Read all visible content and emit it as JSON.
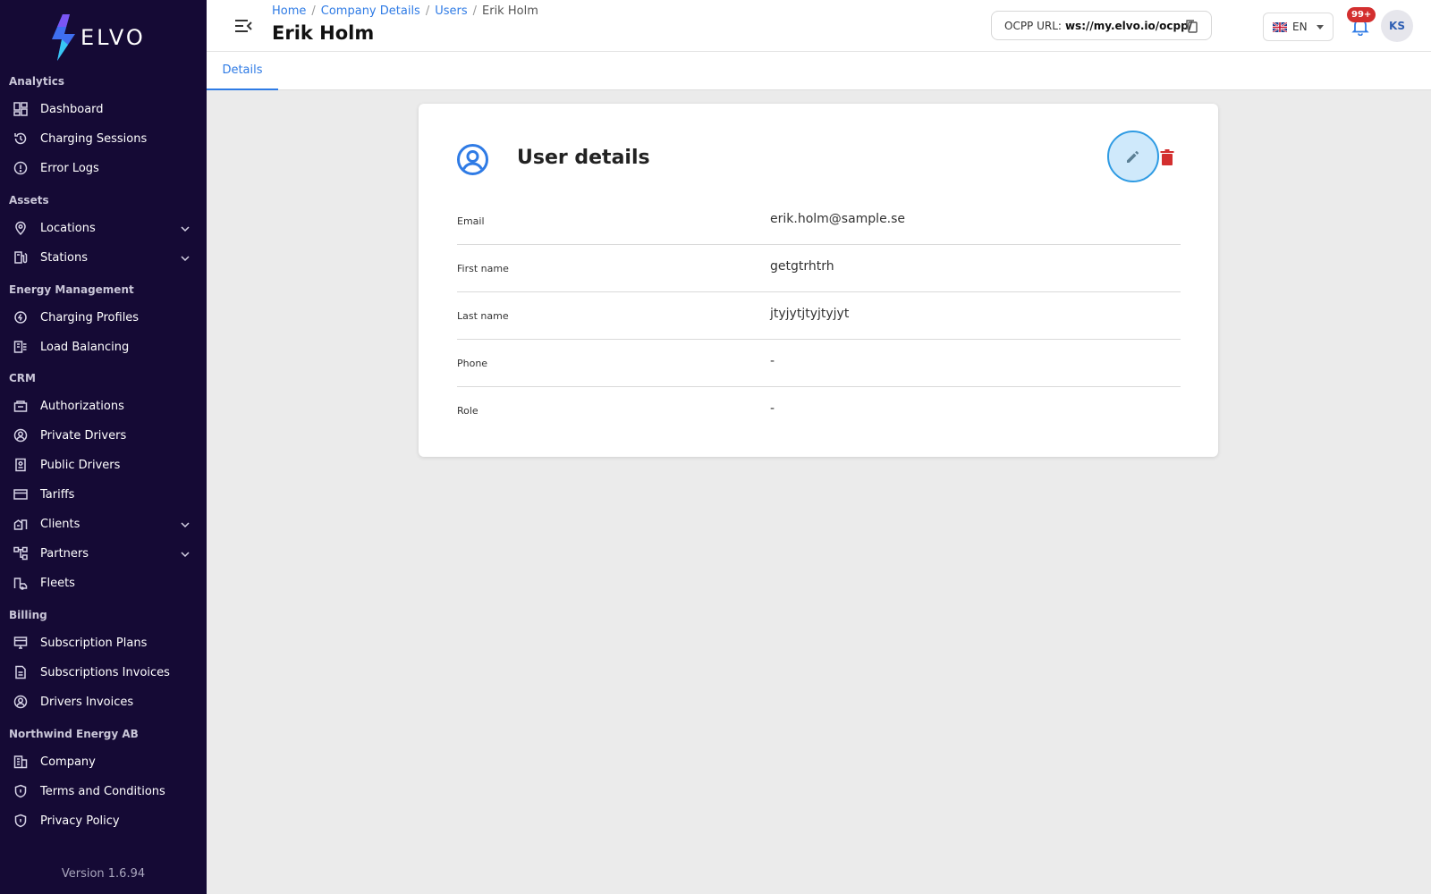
{
  "brand": {
    "name": "ELVO"
  },
  "sidebar": {
    "sections": [
      {
        "title": "Analytics"
      },
      {
        "title": "Assets"
      },
      {
        "title": "Energy Management"
      },
      {
        "title": "CRM"
      },
      {
        "title": "Billing"
      },
      {
        "title": "Northwind Energy AB"
      }
    ],
    "items": [
      {
        "label": "Dashboard",
        "icon": "dashboard-icon"
      },
      {
        "label": "Charging Sessions",
        "icon": "history-icon"
      },
      {
        "label": "Error Logs",
        "icon": "alert-circle-icon"
      },
      {
        "label": "Locations",
        "icon": "location-pin-icon",
        "expandable": true
      },
      {
        "label": "Stations",
        "icon": "charging-station-icon",
        "expandable": true
      },
      {
        "label": "Charging Profiles",
        "icon": "charging-profile-icon"
      },
      {
        "label": "Load Balancing",
        "icon": "load-balancing-icon"
      },
      {
        "label": "Authorizations",
        "icon": "authorization-icon"
      },
      {
        "label": "Private Drivers",
        "icon": "user-circle-icon"
      },
      {
        "label": "Public Drivers",
        "icon": "badge-icon"
      },
      {
        "label": "Tariffs",
        "icon": "credit-card-icon"
      },
      {
        "label": "Clients",
        "icon": "clients-icon",
        "expandable": true
      },
      {
        "label": "Partners",
        "icon": "partners-icon",
        "expandable": true
      },
      {
        "label": "Fleets",
        "icon": "fleet-icon"
      },
      {
        "label": "Subscription Plans",
        "icon": "subscription-icon"
      },
      {
        "label": "Subscriptions Invoices",
        "icon": "document-icon"
      },
      {
        "label": "Drivers Invoices",
        "icon": "user-circle-icon"
      },
      {
        "label": "Company",
        "icon": "company-icon"
      },
      {
        "label": "Terms and Conditions",
        "icon": "shield-icon"
      },
      {
        "label": "Privacy Policy",
        "icon": "shield-icon"
      }
    ],
    "version": "Version 1.6.94"
  },
  "header": {
    "breadcrumb": [
      "Home",
      "Company Details",
      "Users",
      "Erik Holm"
    ],
    "title": "Erik Holm",
    "ocpp_label": "OCPP URL:",
    "ocpp_url": "ws://my.elvo.io/ocpp/",
    "language": "EN",
    "notifications": "99+",
    "avatar_initials": "KS"
  },
  "tabs": [
    {
      "label": "Details",
      "active": true
    }
  ],
  "card": {
    "title": "User details",
    "fields": [
      {
        "label": "Email",
        "value": "erik.holm@sample.se"
      },
      {
        "label": "First name",
        "value": "getgtrhtrh"
      },
      {
        "label": "Last name",
        "value": "jtyjytjtyjtyjyt"
      },
      {
        "label": "Phone",
        "value": "-"
      },
      {
        "label": "Role",
        "value": "-"
      }
    ]
  },
  "colors": {
    "sidebar_bg": "#150a35",
    "accent": "#2f7be5",
    "danger": "#d32f2f",
    "edit_fill": "#cfe9fb"
  }
}
